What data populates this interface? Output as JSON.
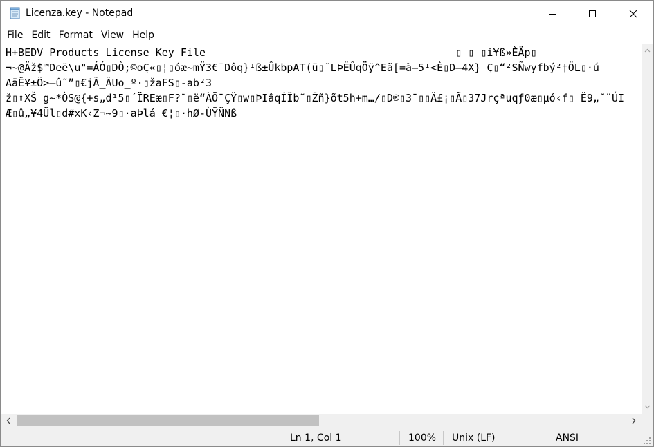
{
  "window": {
    "title": "Licenza.key - Notepad"
  },
  "icons": {
    "app": "notepad-icon",
    "minimize": "minimize-icon",
    "maximize": "maximize-icon",
    "close": "close-icon"
  },
  "menu": [
    "File",
    "Edit",
    "Format",
    "View",
    "Help"
  ],
  "editor": {
    "lines": [
      "H+BEDV Products License Key File                                        ▯ ▯ ▯i¥ß»ÈÄp▯",
      "¬~@Äž$™Deë\\u\"=ÁÓ▯DÒ;©oÇ«▯¦▯óæ~mŸ3€¯Dôq}¹ß±ÛkbpAT(ü▯¨LÞËÛqÖÿ^Eã[=ã–5¹<È▯D—4X} Ç▯“²SÑwyfbý²†ÖL▯·ú",
      "AäÊ¥±Ö>–û˜”▯€jÃ_ÃUo_º·▯žaFS▯-ab²3",
      "ž▯⬆XŠ g~*ÒS@{+s„d¹5▯´ÏREæ▯F?˜▯ë“ÀÖ¯ÇŸ▯w▯ÞIâqÍÏb˜▯Žñ}õt5h+m…/▯D®▯3¯▯▯Ä£¡▯Ã▯37Jrçªuqƒ0æ▯µó‹f▯_Ë9„˜¨ÚI",
      "Æ▯û„¥4Ül▯d#xK‹Z¬~9▯·aÞlá €¦▯·hØ-ÙŸÑNß"
    ]
  },
  "statusbar": {
    "position": "Ln 1, Col 1",
    "zoom": "100%",
    "line_endings": "Unix (LF)",
    "encoding": "ANSI"
  },
  "colors": {
    "chrome": "#f0f0f0",
    "scroll_thumb": "#c1c1c1",
    "text": "#000000"
  }
}
